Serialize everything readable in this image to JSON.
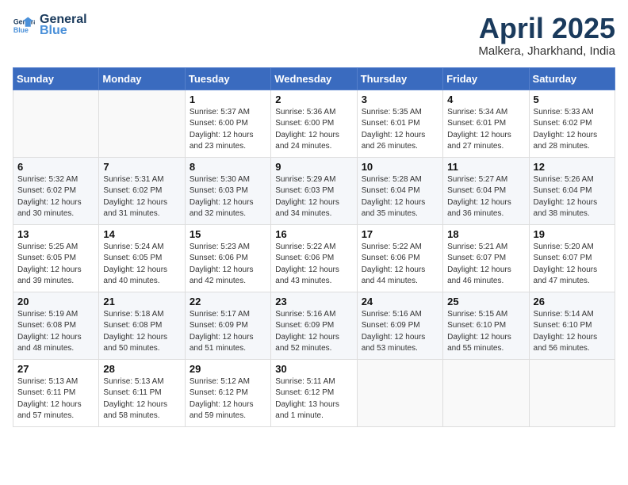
{
  "header": {
    "logo_line1": "General",
    "logo_line2": "Blue",
    "month": "April 2025",
    "location": "Malkera, Jharkhand, India"
  },
  "days_of_week": [
    "Sunday",
    "Monday",
    "Tuesday",
    "Wednesday",
    "Thursday",
    "Friday",
    "Saturday"
  ],
  "weeks": [
    [
      {
        "day": "",
        "detail": ""
      },
      {
        "day": "",
        "detail": ""
      },
      {
        "day": "1",
        "detail": "Sunrise: 5:37 AM\nSunset: 6:00 PM\nDaylight: 12 hours\nand 23 minutes."
      },
      {
        "day": "2",
        "detail": "Sunrise: 5:36 AM\nSunset: 6:00 PM\nDaylight: 12 hours\nand 24 minutes."
      },
      {
        "day": "3",
        "detail": "Sunrise: 5:35 AM\nSunset: 6:01 PM\nDaylight: 12 hours\nand 26 minutes."
      },
      {
        "day": "4",
        "detail": "Sunrise: 5:34 AM\nSunset: 6:01 PM\nDaylight: 12 hours\nand 27 minutes."
      },
      {
        "day": "5",
        "detail": "Sunrise: 5:33 AM\nSunset: 6:02 PM\nDaylight: 12 hours\nand 28 minutes."
      }
    ],
    [
      {
        "day": "6",
        "detail": "Sunrise: 5:32 AM\nSunset: 6:02 PM\nDaylight: 12 hours\nand 30 minutes."
      },
      {
        "day": "7",
        "detail": "Sunrise: 5:31 AM\nSunset: 6:02 PM\nDaylight: 12 hours\nand 31 minutes."
      },
      {
        "day": "8",
        "detail": "Sunrise: 5:30 AM\nSunset: 6:03 PM\nDaylight: 12 hours\nand 32 minutes."
      },
      {
        "day": "9",
        "detail": "Sunrise: 5:29 AM\nSunset: 6:03 PM\nDaylight: 12 hours\nand 34 minutes."
      },
      {
        "day": "10",
        "detail": "Sunrise: 5:28 AM\nSunset: 6:04 PM\nDaylight: 12 hours\nand 35 minutes."
      },
      {
        "day": "11",
        "detail": "Sunrise: 5:27 AM\nSunset: 6:04 PM\nDaylight: 12 hours\nand 36 minutes."
      },
      {
        "day": "12",
        "detail": "Sunrise: 5:26 AM\nSunset: 6:04 PM\nDaylight: 12 hours\nand 38 minutes."
      }
    ],
    [
      {
        "day": "13",
        "detail": "Sunrise: 5:25 AM\nSunset: 6:05 PM\nDaylight: 12 hours\nand 39 minutes."
      },
      {
        "day": "14",
        "detail": "Sunrise: 5:24 AM\nSunset: 6:05 PM\nDaylight: 12 hours\nand 40 minutes."
      },
      {
        "day": "15",
        "detail": "Sunrise: 5:23 AM\nSunset: 6:06 PM\nDaylight: 12 hours\nand 42 minutes."
      },
      {
        "day": "16",
        "detail": "Sunrise: 5:22 AM\nSunset: 6:06 PM\nDaylight: 12 hours\nand 43 minutes."
      },
      {
        "day": "17",
        "detail": "Sunrise: 5:22 AM\nSunset: 6:06 PM\nDaylight: 12 hours\nand 44 minutes."
      },
      {
        "day": "18",
        "detail": "Sunrise: 5:21 AM\nSunset: 6:07 PM\nDaylight: 12 hours\nand 46 minutes."
      },
      {
        "day": "19",
        "detail": "Sunrise: 5:20 AM\nSunset: 6:07 PM\nDaylight: 12 hours\nand 47 minutes."
      }
    ],
    [
      {
        "day": "20",
        "detail": "Sunrise: 5:19 AM\nSunset: 6:08 PM\nDaylight: 12 hours\nand 48 minutes."
      },
      {
        "day": "21",
        "detail": "Sunrise: 5:18 AM\nSunset: 6:08 PM\nDaylight: 12 hours\nand 50 minutes."
      },
      {
        "day": "22",
        "detail": "Sunrise: 5:17 AM\nSunset: 6:09 PM\nDaylight: 12 hours\nand 51 minutes."
      },
      {
        "day": "23",
        "detail": "Sunrise: 5:16 AM\nSunset: 6:09 PM\nDaylight: 12 hours\nand 52 minutes."
      },
      {
        "day": "24",
        "detail": "Sunrise: 5:16 AM\nSunset: 6:09 PM\nDaylight: 12 hours\nand 53 minutes."
      },
      {
        "day": "25",
        "detail": "Sunrise: 5:15 AM\nSunset: 6:10 PM\nDaylight: 12 hours\nand 55 minutes."
      },
      {
        "day": "26",
        "detail": "Sunrise: 5:14 AM\nSunset: 6:10 PM\nDaylight: 12 hours\nand 56 minutes."
      }
    ],
    [
      {
        "day": "27",
        "detail": "Sunrise: 5:13 AM\nSunset: 6:11 PM\nDaylight: 12 hours\nand 57 minutes."
      },
      {
        "day": "28",
        "detail": "Sunrise: 5:13 AM\nSunset: 6:11 PM\nDaylight: 12 hours\nand 58 minutes."
      },
      {
        "day": "29",
        "detail": "Sunrise: 5:12 AM\nSunset: 6:12 PM\nDaylight: 12 hours\nand 59 minutes."
      },
      {
        "day": "30",
        "detail": "Sunrise: 5:11 AM\nSunset: 6:12 PM\nDaylight: 13 hours\nand 1 minute."
      },
      {
        "day": "",
        "detail": ""
      },
      {
        "day": "",
        "detail": ""
      },
      {
        "day": "",
        "detail": ""
      }
    ]
  ]
}
